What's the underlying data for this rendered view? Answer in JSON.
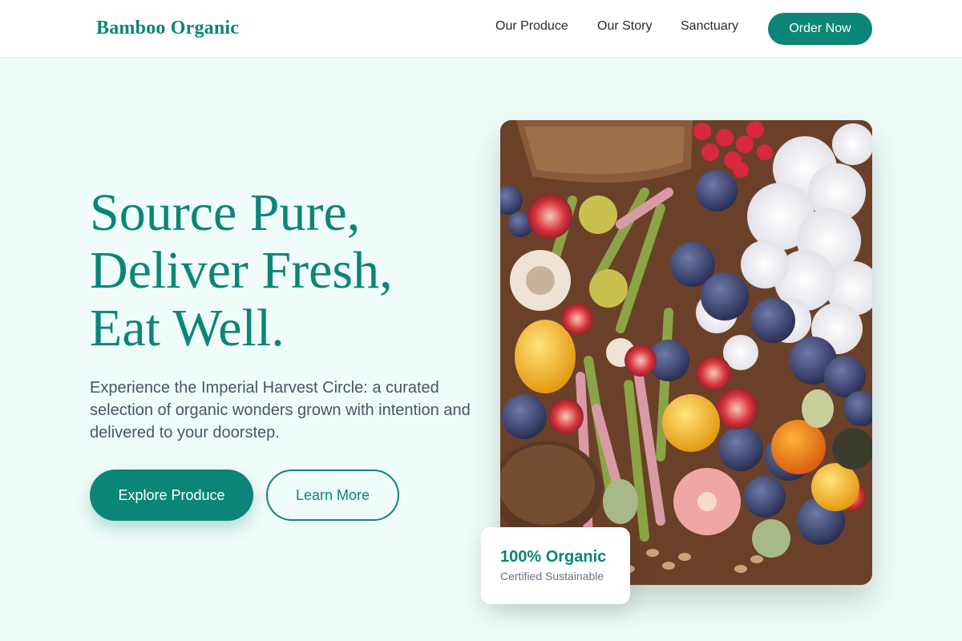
{
  "header": {
    "brand": "Bamboo Organic",
    "nav": [
      "Our Produce",
      "Our Story",
      "Sanctuary"
    ],
    "cta": "Order Now"
  },
  "hero": {
    "title_lines": [
      "Source Pure,",
      "Deliver Fresh,",
      "Eat Well."
    ],
    "subtitle": "Experience the Imperial Harvest Circle: a curated selection of organic wonders grown with intention and delivered to your doorstep.",
    "primary_button": "Explore Produce",
    "secondary_button": "Learn More"
  },
  "image": {
    "alt": "Assorted organic produce: figs, heirloom tomatoes, beans, mushrooms, raspberries, white flowers, and bread on a wooden table"
  },
  "badge": {
    "title": "100% Organic",
    "subtitle": "Certified Sustainable"
  },
  "colors": {
    "brand": "#0b8577",
    "background": "#effcf9",
    "header_bg": "#ffffff",
    "text_body": "#4b5563"
  }
}
